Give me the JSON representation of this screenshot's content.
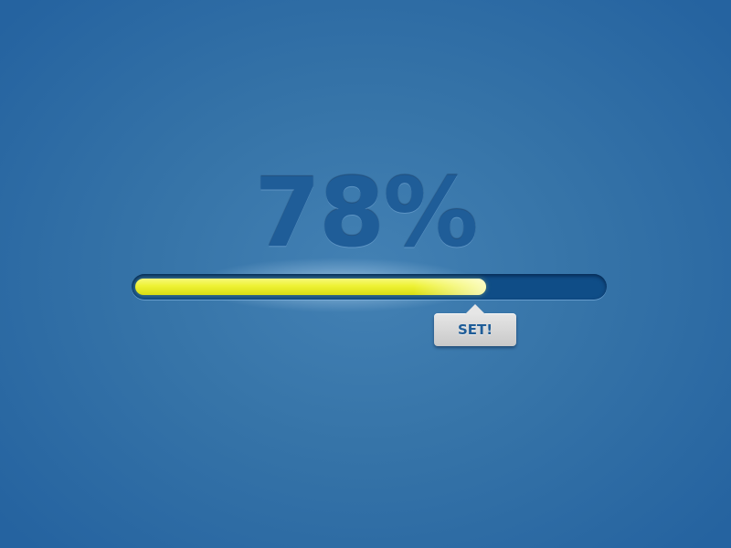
{
  "progress": {
    "percent_label": "78%",
    "value": 0.75,
    "fill_color": "#eef234",
    "track_color": "#0f4d87"
  },
  "tooltip": {
    "label": "SET!"
  },
  "colors": {
    "background": "#3674a8",
    "text": "#1f5d98"
  }
}
